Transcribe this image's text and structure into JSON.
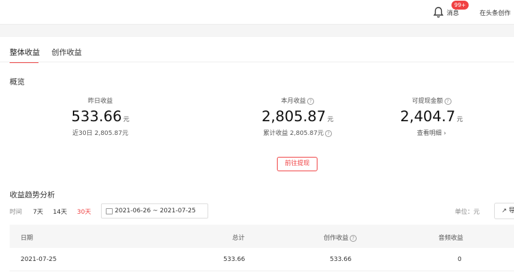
{
  "header": {
    "messages_label": "消息",
    "badge": "99+",
    "user_name": "在头条创作"
  },
  "tabs": [
    {
      "label": "整体收益",
      "active": true
    },
    {
      "label": "创作收益",
      "active": false
    }
  ],
  "overview": {
    "title": "概览",
    "stats": [
      {
        "label": "昨日收益",
        "value": "533.66",
        "unit": "元",
        "sub": "近30日 2,805.87元"
      },
      {
        "label": "本月收益",
        "value": "2,805.87",
        "unit": "元",
        "sub": "累计收益 2,805.87元"
      },
      {
        "label": "可提现金额",
        "value": "2,404.7",
        "unit": "元",
        "sub": "查看明细 ›"
      }
    ],
    "withdraw_button": "前往提现"
  },
  "trend": {
    "title": "收益趋势分析",
    "time_label": "时间",
    "ranges": [
      "7天",
      "14天",
      "30天"
    ],
    "active_range": "30天",
    "date_range": "2021-06-26 ~ 2021-07-25",
    "unit_label": "单位：元",
    "export_label": "↗ 导出",
    "columns": [
      "日期",
      "总计",
      "创作收益",
      "音频收益"
    ],
    "rows": [
      [
        "2021-07-25",
        "533.66",
        "533.66",
        "0"
      ]
    ]
  },
  "colors": {
    "accent": "#f04142"
  }
}
